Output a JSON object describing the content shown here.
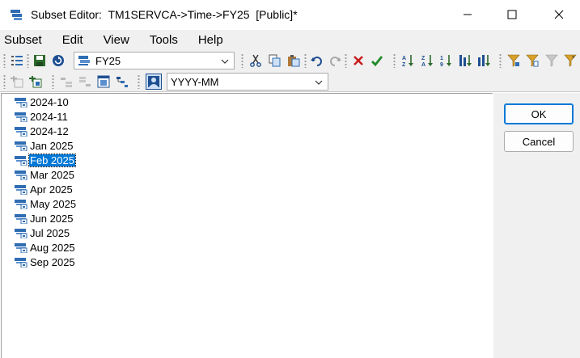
{
  "window": {
    "title": "Subset Editor:  TM1SERVCA->Time->FY25  [Public]*",
    "icon": "subset-editor-icon",
    "controls": [
      "minimize",
      "maximize",
      "close"
    ]
  },
  "menu": {
    "items": [
      {
        "label": "Subset",
        "name": "menu-subset"
      },
      {
        "label": "Edit",
        "name": "menu-edit"
      },
      {
        "label": "View",
        "name": "menu-view"
      },
      {
        "label": "Tools",
        "name": "menu-tools"
      },
      {
        "label": "Help",
        "name": "menu-help"
      }
    ]
  },
  "toolbar": {
    "subset_combo": {
      "value": "FY25"
    },
    "alias_combo": {
      "value": "YYYY-MM"
    }
  },
  "tree": {
    "elements": [
      {
        "label": "2024-10",
        "selected": false
      },
      {
        "label": "2024-11",
        "selected": false
      },
      {
        "label": "2024-12",
        "selected": false
      },
      {
        "label": "Jan 2025",
        "selected": false
      },
      {
        "label": "Feb 2025",
        "selected": true
      },
      {
        "label": "Mar 2025",
        "selected": false
      },
      {
        "label": "Apr 2025",
        "selected": false
      },
      {
        "label": "May 2025",
        "selected": false
      },
      {
        "label": "Jun 2025",
        "selected": false
      },
      {
        "label": "Jul 2025",
        "selected": false
      },
      {
        "label": "Aug 2025",
        "selected": false
      },
      {
        "label": "Sep 2025",
        "selected": false
      }
    ]
  },
  "buttons": {
    "ok": "OK",
    "cancel": "Cancel"
  },
  "colors": {
    "selection": "#0078d7",
    "toolbar_bg": "#f0f0f0",
    "element_icon": "#2f6db3"
  }
}
